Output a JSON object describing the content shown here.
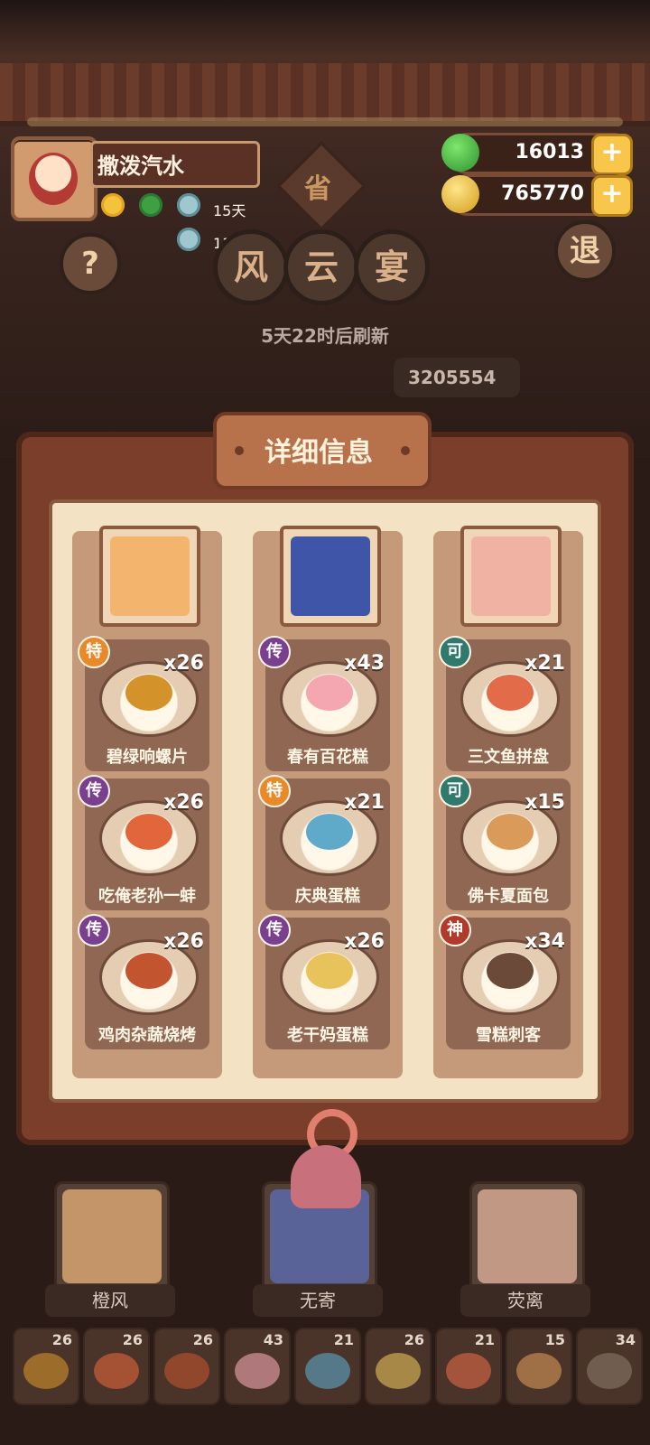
{
  "player": {
    "name": "撒泼汽水",
    "buff_days": [
      "15天",
      "11天"
    ]
  },
  "currency": {
    "jade": "16013",
    "coins": "765770"
  },
  "buttons": {
    "help": "?",
    "quit": "退"
  },
  "event": {
    "province": "省",
    "title_chars": [
      "风",
      "云",
      "宴"
    ],
    "refresh": "5天22时后刷新",
    "score": "3205554"
  },
  "panel": {
    "title": "详细信息"
  },
  "columns": [
    {
      "character": "橙风",
      "items": [
        {
          "badge": "特",
          "qty": "x26",
          "name": "碧绿响螺片"
        },
        {
          "badge": "传",
          "qty": "x26",
          "name": "吃俺老孙一蚌"
        },
        {
          "badge": "传",
          "qty": "x26",
          "name": "鸡肉杂蔬烧烤"
        }
      ]
    },
    {
      "character": "无寄",
      "items": [
        {
          "badge": "传",
          "qty": "x43",
          "name": "春有百花糕"
        },
        {
          "badge": "特",
          "qty": "x21",
          "name": "庆典蛋糕"
        },
        {
          "badge": "传",
          "qty": "x26",
          "name": "老干妈蛋糕"
        }
      ]
    },
    {
      "character": "荧离",
      "items": [
        {
          "badge": "可",
          "qty": "x21",
          "name": "三文鱼拼盘"
        },
        {
          "badge": "可",
          "qty": "x15",
          "name": "佛卡夏面包"
        },
        {
          "badge": "神",
          "qty": "x34",
          "name": "雪糕刺客"
        }
      ]
    }
  ],
  "strip": [
    "26",
    "26",
    "26",
    "43",
    "21",
    "26",
    "21",
    "15",
    "34"
  ],
  "badge_colors": {
    "特": "#e8892a",
    "传": "#7b3f8f",
    "可": "#2f7a6c",
    "神": "#b23a2a"
  }
}
